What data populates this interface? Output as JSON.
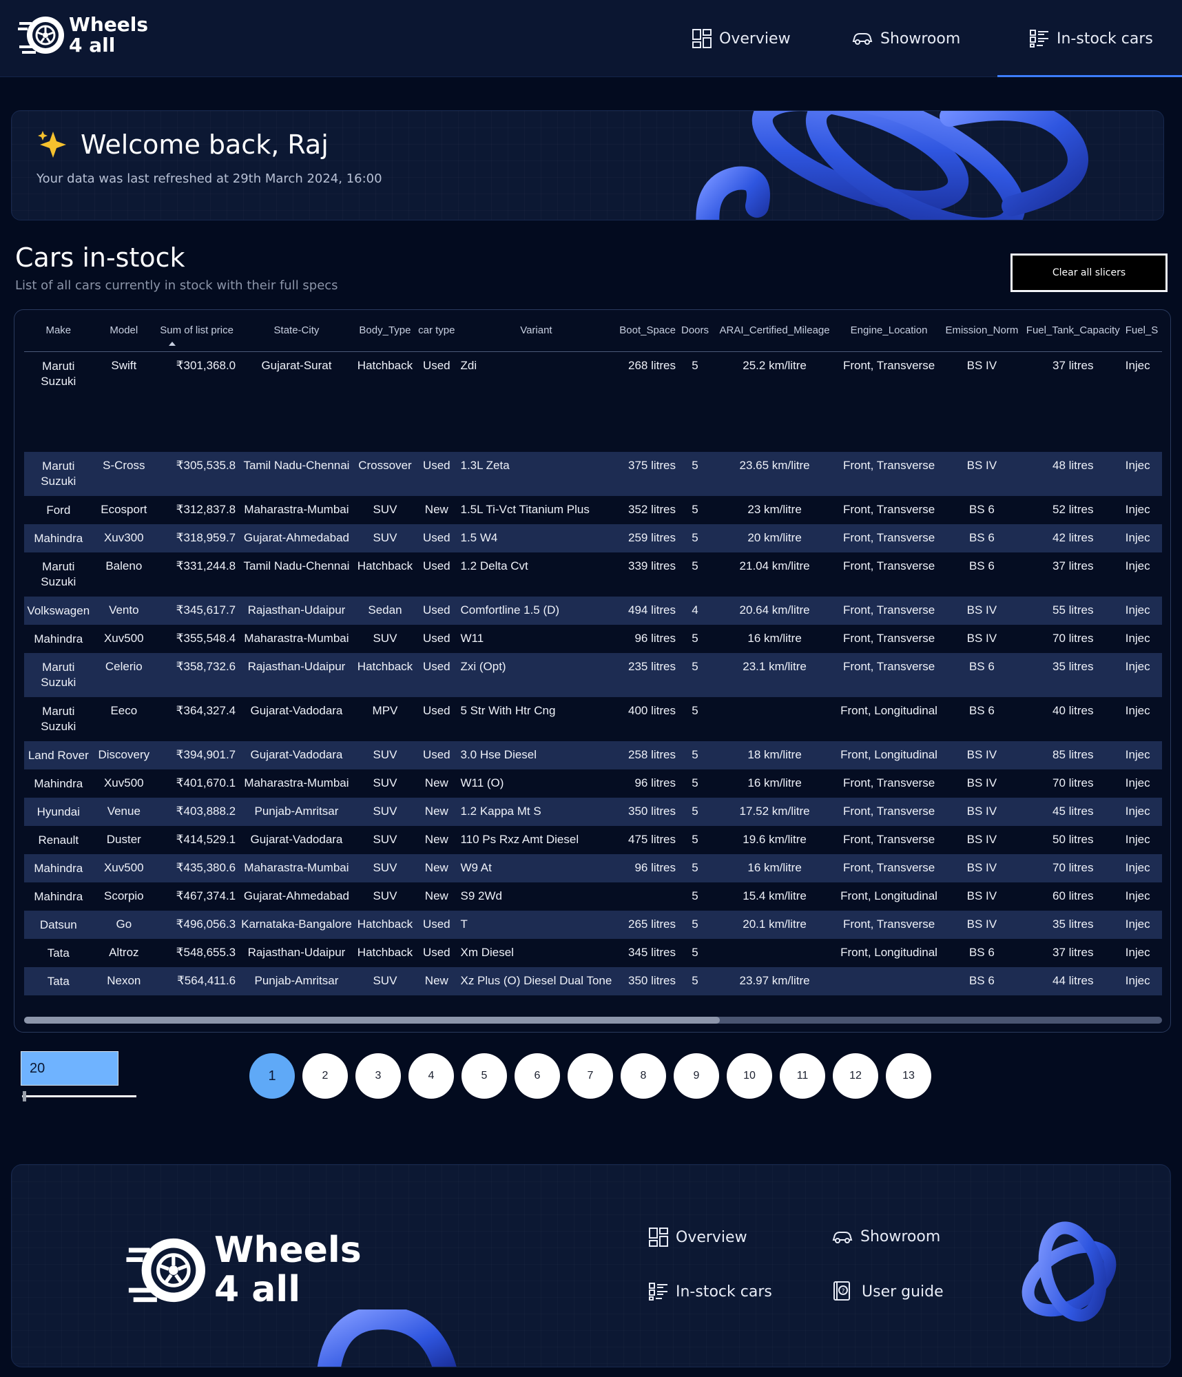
{
  "header": {
    "logo_line1": "Wheels",
    "logo_line2": "4 all",
    "nav": [
      {
        "label": "Overview",
        "icon": "dashboard-icon"
      },
      {
        "label": "Showroom",
        "icon": "car-icon"
      },
      {
        "label": "In-stock cars",
        "icon": "list-icon",
        "active": true
      }
    ]
  },
  "welcome": {
    "title": "Welcome back, Raj",
    "subtitle": "Your data was last refreshed at 29th March 2024, 16:00"
  },
  "section": {
    "title": "Cars in-stock",
    "subtitle": "List of all cars currently in stock with their full specs",
    "clear_button": "Clear all slicers"
  },
  "table": {
    "columns": [
      "Make",
      "Model",
      "Sum of list price",
      "State-City",
      "Body_Type",
      "car type",
      "Variant",
      "Boot_Space",
      "Doors",
      "ARAI_Certified_Mileage",
      "Engine_Location",
      "Emission_Norm",
      "Fuel_Tank_Capacity",
      "Fuel_S"
    ],
    "rows": [
      [
        "Maruti Suzuki",
        "Swift",
        "₹301,368.0",
        "Gujarat-Surat",
        "Hatchback",
        "Used",
        "Zdi",
        "268 litres",
        "5",
        "25.2 km/litre",
        "Front, Transverse",
        "BS IV",
        "37 litres",
        "Injec"
      ],
      [
        "Maruti Suzuki",
        "S-Cross",
        "₹305,535.8",
        "Tamil Nadu-Chennai",
        "Crossover",
        "Used",
        "1.3L Zeta",
        "375 litres",
        "5",
        "23.65 km/litre",
        "Front, Transverse",
        "BS IV",
        "48 litres",
        "Injec"
      ],
      [
        "Ford",
        "Ecosport",
        "₹312,837.8",
        "Maharastra-Mumbai",
        "SUV",
        "New",
        "1.5L Ti-Vct Titanium Plus",
        "352 litres",
        "5",
        "23 km/litre",
        "Front, Transverse",
        "BS 6",
        "52 litres",
        "Injec"
      ],
      [
        "Mahindra",
        "Xuv300",
        "₹318,959.7",
        "Gujarat-Ahmedabad",
        "SUV",
        "Used",
        "1.5 W4",
        "259 litres",
        "5",
        "20 km/litre",
        "Front, Transverse",
        "BS 6",
        "42 litres",
        "Injec"
      ],
      [
        "Maruti Suzuki",
        "Baleno",
        "₹331,244.8",
        "Tamil Nadu-Chennai",
        "Hatchback",
        "Used",
        "1.2 Delta Cvt",
        "339 litres",
        "5",
        "21.04 km/litre",
        "Front, Transverse",
        "BS 6",
        "37 litres",
        "Injec"
      ],
      [
        "Volkswagen",
        "Vento",
        "₹345,617.7",
        "Rajasthan-Udaipur",
        "Sedan",
        "Used",
        "Comfortline 1.5 (D)",
        "494 litres",
        "4",
        "20.64 km/litre",
        "Front, Transverse",
        "BS IV",
        "55 litres",
        "Injec"
      ],
      [
        "Mahindra",
        "Xuv500",
        "₹355,548.4",
        "Maharastra-Mumbai",
        "SUV",
        "Used",
        "W11",
        "96 litres",
        "5",
        "16 km/litre",
        "Front, Transverse",
        "BS IV",
        "70 litres",
        "Injec"
      ],
      [
        "Maruti Suzuki",
        "Celerio",
        "₹358,732.6",
        "Rajasthan-Udaipur",
        "Hatchback",
        "Used",
        "Zxi (Opt)",
        "235 litres",
        "5",
        "23.1 km/litre",
        "Front, Transverse",
        "BS 6",
        "35 litres",
        "Injec"
      ],
      [
        "Maruti Suzuki",
        "Eeco",
        "₹364,327.4",
        "Gujarat-Vadodara",
        "MPV",
        "Used",
        "5 Str With Htr Cng",
        "400 litres",
        "5",
        "",
        "Front, Longitudinal",
        "BS 6",
        "40 litres",
        "Injec"
      ],
      [
        "Land Rover",
        "Discovery",
        "₹394,901.7",
        "Gujarat-Vadodara",
        "SUV",
        "Used",
        "3.0 Hse Diesel",
        "258 litres",
        "5",
        "18 km/litre",
        "Front, Longitudinal",
        "BS IV",
        "85 litres",
        "Injec"
      ],
      [
        "Mahindra",
        "Xuv500",
        "₹401,670.1",
        "Maharastra-Mumbai",
        "SUV",
        "New",
        "W11 (O)",
        "96 litres",
        "5",
        "16 km/litre",
        "Front, Transverse",
        "BS IV",
        "70 litres",
        "Injec"
      ],
      [
        "Hyundai",
        "Venue",
        "₹403,888.2",
        "Punjab-Amritsar",
        "SUV",
        "New",
        "1.2 Kappa Mt S",
        "350 litres",
        "5",
        "17.52 km/litre",
        "Front, Transverse",
        "BS IV",
        "45 litres",
        "Injec"
      ],
      [
        "Renault",
        "Duster",
        "₹414,529.1",
        "Gujarat-Vadodara",
        "SUV",
        "New",
        "110 Ps Rxz Amt Diesel",
        "475 litres",
        "5",
        "19.6 km/litre",
        "Front, Transverse",
        "BS IV",
        "50 litres",
        "Injec"
      ],
      [
        "Mahindra",
        "Xuv500",
        "₹435,380.6",
        "Maharastra-Mumbai",
        "SUV",
        "New",
        "W9 At",
        "96 litres",
        "5",
        "16 km/litre",
        "Front, Transverse",
        "BS IV",
        "70 litres",
        "Injec"
      ],
      [
        "Mahindra",
        "Scorpio",
        "₹467,374.1",
        "Gujarat-Ahmedabad",
        "SUV",
        "New",
        "S9 2Wd",
        "",
        "5",
        "15.4 km/litre",
        "Front, Longitudinal",
        "BS IV",
        "60 litres",
        "Injec"
      ],
      [
        "Datsun",
        "Go",
        "₹496,056.3",
        "Karnataka-Bangalore",
        "Hatchback",
        "Used",
        "T",
        "265 litres",
        "5",
        "20.1 km/litre",
        "Front, Transverse",
        "BS IV",
        "35 litres",
        "Injec"
      ],
      [
        "Tata",
        "Altroz",
        "₹548,655.3",
        "Rajasthan-Udaipur",
        "Hatchback",
        "Used",
        "Xm Diesel",
        "345 litres",
        "5",
        "",
        "Front, Longitudinal",
        "BS 6",
        "37 litres",
        "Injec"
      ],
      [
        "Tata",
        "Nexon",
        "₹564,411.6",
        "Punjab-Amritsar",
        "SUV",
        "New",
        "Xz Plus (O) Diesel Dual Tone",
        "350 litres",
        "5",
        "23.97 km/litre",
        "",
        "BS 6",
        "44 litres",
        "Injec"
      ]
    ]
  },
  "pagination": {
    "page_size": "20",
    "pages": [
      "1",
      "2",
      "3",
      "4",
      "5",
      "6",
      "7",
      "8",
      "9",
      "10",
      "11",
      "12",
      "13"
    ],
    "current_page": "1"
  },
  "footer": {
    "logo_line1": "Wheels",
    "logo_line2": "4 all",
    "links": [
      {
        "label": "Overview",
        "icon": "dashboard-icon"
      },
      {
        "label": "Showroom",
        "icon": "car-icon"
      },
      {
        "label": "In-stock cars",
        "icon": "list-icon"
      },
      {
        "label": "User guide",
        "icon": "help-book-icon"
      }
    ]
  },
  "colors": {
    "background": "#030b1f",
    "header": "#0b1631",
    "accent": "#3d7dff",
    "row_alt": "#1d2c52",
    "active_page": "#5fa9f7"
  }
}
